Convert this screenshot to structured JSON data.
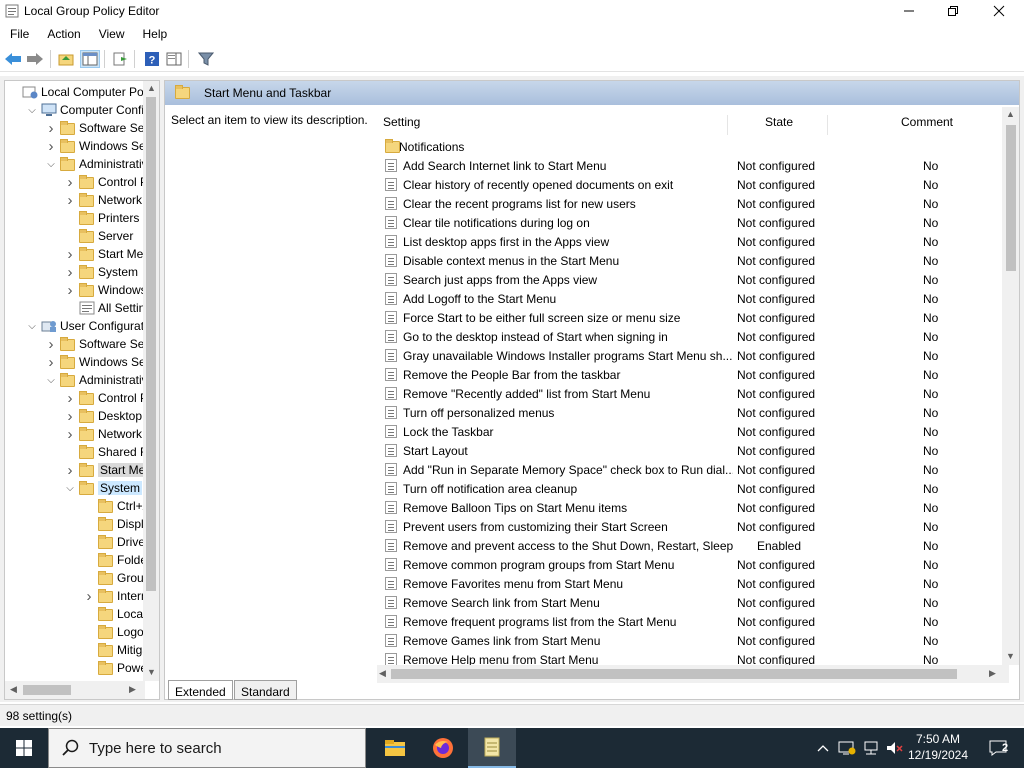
{
  "window": {
    "title": "Local Group Policy Editor"
  },
  "menubar": {
    "items": [
      "File",
      "Action",
      "View",
      "Help"
    ]
  },
  "tree": {
    "items": [
      {
        "label": "Local Computer Polic",
        "icon": "computer-policy-icon",
        "expander": ""
      },
      {
        "label": "Computer Configu",
        "icon": "computer-icon",
        "expander": "v"
      },
      {
        "label": "Software Setti",
        "icon": "folder-icon",
        "expander": ">"
      },
      {
        "label": "Windows Sett",
        "icon": "folder-icon",
        "expander": ">"
      },
      {
        "label": "Administrative",
        "icon": "folder-icon",
        "expander": "v"
      },
      {
        "label": "Control Pa",
        "icon": "folder-icon",
        "expander": ">"
      },
      {
        "label": "Network",
        "icon": "folder-icon",
        "expander": ">"
      },
      {
        "label": "Printers",
        "icon": "folder-icon",
        "expander": ""
      },
      {
        "label": "Server",
        "icon": "folder-icon",
        "expander": ""
      },
      {
        "label": "Start Menu",
        "icon": "folder-icon",
        "expander": ">"
      },
      {
        "label": "System",
        "icon": "folder-icon",
        "expander": ">"
      },
      {
        "label": "Windows C",
        "icon": "folder-icon",
        "expander": ">"
      },
      {
        "label": "All Setting",
        "icon": "settings-icon",
        "expander": ""
      },
      {
        "label": "User Configuratio",
        "icon": "user-icon",
        "expander": "v"
      },
      {
        "label": "Software Setti",
        "icon": "folder-icon",
        "expander": ">"
      },
      {
        "label": "Windows Sett",
        "icon": "folder-icon",
        "expander": ">"
      },
      {
        "label": "Administrative",
        "icon": "folder-icon",
        "expander": "v"
      },
      {
        "label": "Control Pa",
        "icon": "folder-icon",
        "expander": ">"
      },
      {
        "label": "Desktop",
        "icon": "folder-icon",
        "expander": ">"
      },
      {
        "label": "Network",
        "icon": "folder-icon",
        "expander": ">"
      },
      {
        "label": "Shared Fol",
        "icon": "folder-icon",
        "expander": ""
      },
      {
        "label": "Start Menu",
        "icon": "folder-icon",
        "expander": ">"
      },
      {
        "label": "System",
        "icon": "folder-icon",
        "expander": "v"
      },
      {
        "label": "Ctrl+A",
        "icon": "folder-icon",
        "expander": ""
      },
      {
        "label": "Display",
        "icon": "folder-icon",
        "expander": ""
      },
      {
        "label": "Driver",
        "icon": "folder-icon",
        "expander": ""
      },
      {
        "label": "Folder",
        "icon": "folder-icon",
        "expander": ""
      },
      {
        "label": "Group",
        "icon": "folder-icon",
        "expander": ""
      },
      {
        "label": "Interne",
        "icon": "folder-icon",
        "expander": ">"
      },
      {
        "label": "Locale",
        "icon": "folder-icon",
        "expander": ""
      },
      {
        "label": "Logon",
        "icon": "folder-icon",
        "expander": ""
      },
      {
        "label": "Mitiga",
        "icon": "folder-icon",
        "expander": ""
      },
      {
        "label": "Power",
        "icon": "folder-icon",
        "expander": ""
      }
    ]
  },
  "right": {
    "header_title": "Start Menu and Taskbar",
    "description": "Select an item to view its description.",
    "columns": {
      "setting": "Setting",
      "state": "State",
      "comment": "Comment"
    },
    "folder_row": "Notifications",
    "rows": [
      {
        "name": "Add Search Internet link to Start Menu",
        "state": "Not configured",
        "comment": "No"
      },
      {
        "name": "Clear history of recently opened documents on exit",
        "state": "Not configured",
        "comment": "No"
      },
      {
        "name": "Clear the recent programs list for new users",
        "state": "Not configured",
        "comment": "No"
      },
      {
        "name": "Clear tile notifications during log on",
        "state": "Not configured",
        "comment": "No"
      },
      {
        "name": "List desktop apps first in the Apps view",
        "state": "Not configured",
        "comment": "No"
      },
      {
        "name": "Disable context menus in the Start Menu",
        "state": "Not configured",
        "comment": "No"
      },
      {
        "name": "Search just apps from the Apps view",
        "state": "Not configured",
        "comment": "No"
      },
      {
        "name": "Add Logoff to the Start Menu",
        "state": "Not configured",
        "comment": "No"
      },
      {
        "name": "Force Start to be either full screen size or menu size",
        "state": "Not configured",
        "comment": "No"
      },
      {
        "name": "Go to the desktop instead of Start when signing in",
        "state": "Not configured",
        "comment": "No"
      },
      {
        "name": "Gray unavailable Windows Installer programs Start Menu sh...",
        "state": "Not configured",
        "comment": "No"
      },
      {
        "name": "Remove the People Bar from the taskbar",
        "state": "Not configured",
        "comment": "No"
      },
      {
        "name": "Remove \"Recently added\" list from Start Menu",
        "state": "Not configured",
        "comment": "No"
      },
      {
        "name": "Turn off personalized menus",
        "state": "Not configured",
        "comment": "No"
      },
      {
        "name": "Lock the Taskbar",
        "state": "Not configured",
        "comment": "No"
      },
      {
        "name": "Start Layout",
        "state": "Not configured",
        "comment": "No"
      },
      {
        "name": "Add \"Run in Separate Memory Space\" check box to Run dial...",
        "state": "Not configured",
        "comment": "No"
      },
      {
        "name": "Turn off notification area cleanup",
        "state": "Not configured",
        "comment": "No"
      },
      {
        "name": "Remove Balloon Tips on Start Menu items",
        "state": "Not configured",
        "comment": "No"
      },
      {
        "name": "Prevent users from customizing their Start Screen",
        "state": "Not configured",
        "comment": "No"
      },
      {
        "name": "Remove and prevent access to the Shut Down, Restart, Sleep...",
        "state": "Enabled",
        "comment": "No"
      },
      {
        "name": "Remove common program groups from Start Menu",
        "state": "Not configured",
        "comment": "No"
      },
      {
        "name": "Remove Favorites menu from Start Menu",
        "state": "Not configured",
        "comment": "No"
      },
      {
        "name": "Remove Search link from Start Menu",
        "state": "Not configured",
        "comment": "No"
      },
      {
        "name": "Remove frequent programs list from the Start Menu",
        "state": "Not configured",
        "comment": "No"
      },
      {
        "name": "Remove Games link from Start Menu",
        "state": "Not configured",
        "comment": "No"
      },
      {
        "name": "Remove Help menu from Start Menu",
        "state": "Not configured",
        "comment": "No"
      }
    ]
  },
  "tabs": {
    "extended": "Extended",
    "standard": "Standard"
  },
  "status": {
    "text": "98 setting(s)"
  },
  "taskbar": {
    "search_placeholder": "Type here to search",
    "time": "7:50 AM",
    "date": "12/19/2024",
    "notification_count": "2"
  },
  "colors": {
    "taskbar_bg": "#1c2a35",
    "header_gradient": "#b4c9e2",
    "selection": "#d9d9d9"
  }
}
